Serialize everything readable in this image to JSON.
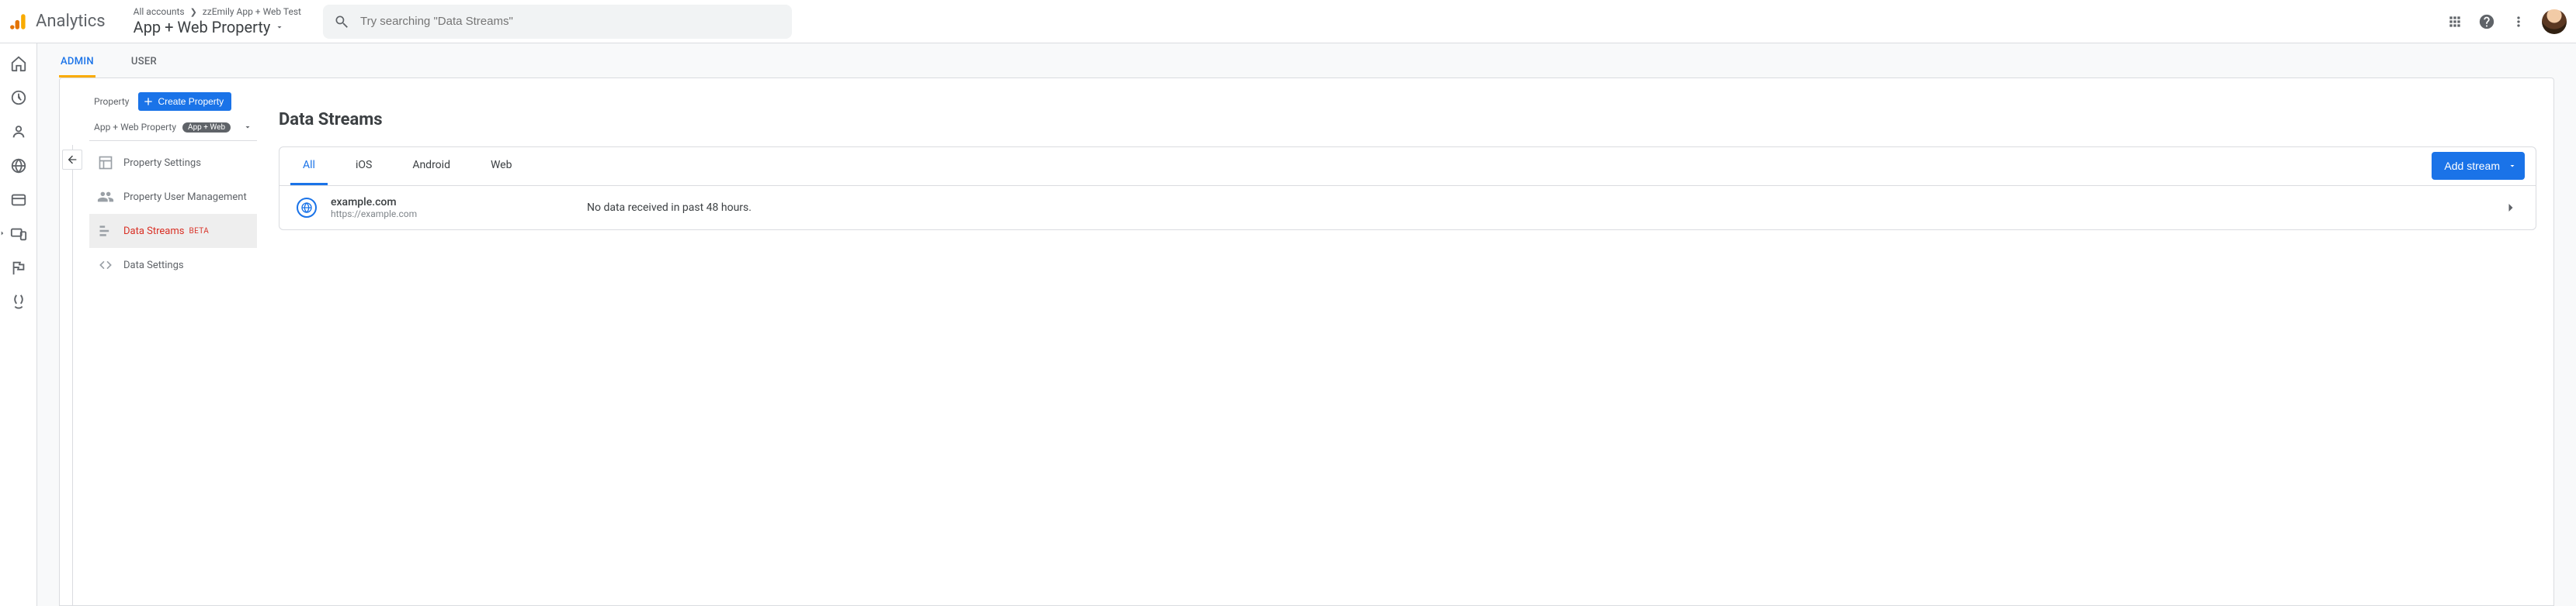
{
  "header": {
    "product": "Analytics",
    "breadcrumb_part1": "All accounts",
    "breadcrumb_part2": "zzEmily App + Web Test",
    "property_name": "App + Web Property",
    "search_placeholder": "Try searching \"Data Streams\""
  },
  "admin_tabs": {
    "admin": "ADMIN",
    "user": "USER"
  },
  "prop_col": {
    "label": "Property",
    "create_btn": "Create Property",
    "selector_name": "App + Web Property",
    "selector_badge": "App + Web",
    "items": [
      {
        "label": "Property Settings"
      },
      {
        "label": "Property User Management"
      },
      {
        "label": "Data Streams",
        "beta": "BETA"
      },
      {
        "label": "Data Settings"
      }
    ]
  },
  "streams": {
    "title": "Data Streams",
    "tabs": {
      "all": "All",
      "ios": "iOS",
      "android": "Android",
      "web": "Web"
    },
    "add_btn": "Add stream",
    "row": {
      "name": "example.com",
      "url": "https://example.com",
      "status": "No data received in past 48 hours."
    }
  }
}
